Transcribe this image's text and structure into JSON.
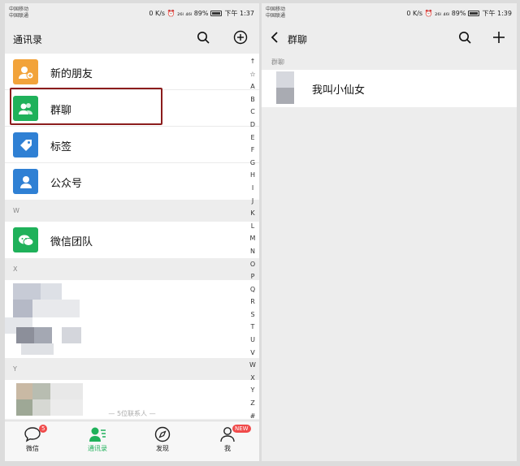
{
  "left": {
    "status": {
      "carrier1": "中国移动",
      "carrier2": "中国联通",
      "right": "0 K/s ⏰ ₂₆ₗ ₄₆ₗ 89%",
      "time": "下午 1:37"
    },
    "title": "通讯录",
    "rows": [
      {
        "label": "新的朋友",
        "icon": "add-friend-icon",
        "color": "#f2a33a"
      },
      {
        "label": "群聊",
        "icon": "group-chat-icon",
        "color": "#1fb15a"
      },
      {
        "label": "标签",
        "icon": "tag-icon",
        "color": "#2f80d4"
      },
      {
        "label": "公众号",
        "icon": "official-account-icon",
        "color": "#2f80d4"
      }
    ],
    "section_w": "W",
    "wechat_team": "微信团队",
    "section_x": "X",
    "section_y": "Y",
    "index": [
      "↑",
      "☆",
      "A",
      "B",
      "C",
      "D",
      "E",
      "F",
      "G",
      "H",
      "I",
      "J",
      "K",
      "L",
      "M",
      "N",
      "O",
      "P",
      "Q",
      "R",
      "S",
      "T",
      "U",
      "V",
      "W",
      "X",
      "Y",
      "Z",
      "#"
    ],
    "tabs": [
      {
        "label": "微信",
        "badge": "5",
        "active": false
      },
      {
        "label": "通讯录",
        "active": true
      },
      {
        "label": "发现",
        "active": false
      },
      {
        "label": "我",
        "badge": "NEW",
        "active": false
      }
    ],
    "ghost_text": "— 5位联系人 —"
  },
  "right": {
    "status": {
      "carrier1": "中国移动",
      "carrier2": "中国联通",
      "right": "0 K/s ⏰ ₂₆ₗ ₄₆ₗ 89%",
      "time": "下午 1:39"
    },
    "title": "群聊",
    "section": "群聊",
    "group_name": "我叫小仙女"
  },
  "colors": {
    "accent_green": "#1fb15a",
    "highlight_red": "#8b1c1c"
  }
}
